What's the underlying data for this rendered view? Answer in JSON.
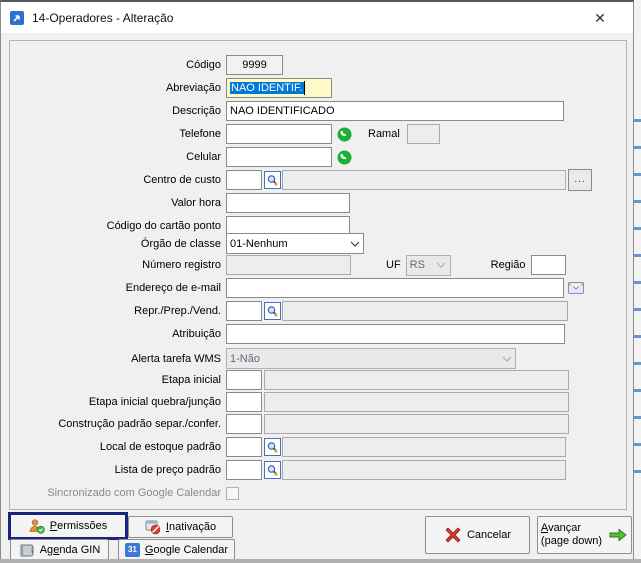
{
  "window": {
    "title": "14-Operadores - Alteração",
    "close_glyph": "✕"
  },
  "form": {
    "codigo": {
      "label": "Código",
      "value": "9999"
    },
    "abreviacao": {
      "label": "Abreviação",
      "value": "NAO IDENTIF."
    },
    "descricao": {
      "label": "Descrição",
      "value": "NAO IDENTIFICADO"
    },
    "telefone": {
      "label": "Telefone",
      "value": ""
    },
    "ramal": {
      "label": "Ramal",
      "value": ""
    },
    "celular": {
      "label": "Celular",
      "value": ""
    },
    "centro_custo": {
      "label": "Centro de custo",
      "code": "",
      "description": "",
      "more_label": "..."
    },
    "valor_hora": {
      "label": "Valor hora",
      "value": ""
    },
    "cartao_ponto": {
      "label": "Código do cartão ponto",
      "value": ""
    },
    "orgao_classe": {
      "label": "Órgão de classe",
      "value": "01-Nenhum"
    },
    "numero_registro": {
      "label": "Número registro",
      "value": ""
    },
    "uf": {
      "label": "UF",
      "value": "RS"
    },
    "regiao": {
      "label": "Região",
      "value": ""
    },
    "email": {
      "label": "Endereço de e-mail",
      "value": ""
    },
    "repr": {
      "label": "Repr./Prep./Vend.",
      "code": "",
      "description": ""
    },
    "atribuicao": {
      "label": "Atribuição",
      "value": ""
    },
    "alerta_wms": {
      "label": "Alerta tarefa WMS",
      "value": "1-Não"
    },
    "etapa_inicial": {
      "label": "Etapa inicial",
      "code": "",
      "description": ""
    },
    "etapa_quebra": {
      "label": "Etapa inicial quebra/junção",
      "code": "",
      "description": ""
    },
    "construcao": {
      "label": "Construção padrão separ./confer.",
      "code": "",
      "description": ""
    },
    "local_estoque": {
      "label": "Local de estoque padrão",
      "code": "",
      "description": ""
    },
    "lista_preco": {
      "label": "Lista de preço padrão",
      "code": "",
      "description": ""
    },
    "sincronizado": {
      "label": "Sincronizado com Google Calendar"
    }
  },
  "buttons": {
    "permissoes": {
      "key": "P",
      "post": "ermissões"
    },
    "inativacao": {
      "key": "I",
      "post": "nativação"
    },
    "agenda_gin": {
      "pre": "Ag",
      "key": "e",
      "post": "nda GIN"
    },
    "google_calendar": {
      "key": "G",
      "post": "oogle Calendar",
      "badge": "31"
    },
    "cancelar": {
      "label": "Cancelar"
    },
    "avancar": {
      "key": "A",
      "post": "vançar",
      "line2": "(page down)"
    }
  },
  "icons": {
    "whatsapp": "whatsapp-phone",
    "magnifier": "search-lookup",
    "envelope": "e-mail",
    "permissoes": "user-with-check",
    "inativacao": "window-prohibited",
    "agenda": "address-book",
    "google_calendar": "calendar-31",
    "cancelar": "red-x",
    "avancar": "green-right-arrow",
    "app": "blue-diagonal-arrow"
  },
  "colors": {
    "selection_blue": "#0078d7",
    "field_yellow": "#fffbc8",
    "whatsapp_green": "#1faf38",
    "focus_ring_navy": "#1a237e",
    "dialog_bg": "#f0f0f0",
    "arrow_green": "#52c234",
    "cancel_red": "#d23b2f"
  }
}
